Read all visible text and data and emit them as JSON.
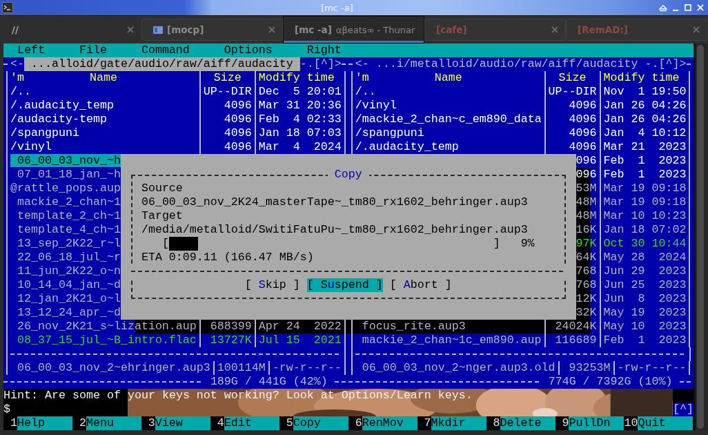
{
  "window": {
    "title": "[mc -a]"
  },
  "tabs": [
    {
      "label": "//",
      "selected": false,
      "alert": false,
      "icon": false
    },
    {
      "label": "[mocp]",
      "selected": false,
      "alert": false,
      "icon": true
    },
    {
      "label": "[mc -a]",
      "subtitle": "αβeats∞ - Thunar",
      "selected": true,
      "alert": false,
      "icon": false
    },
    {
      "label": "[cafe]",
      "selected": false,
      "alert": true,
      "icon": false
    },
    {
      "label": "[RemAD:]",
      "selected": false,
      "alert": true,
      "icon": false
    }
  ],
  "menu": [
    "Left",
    "File",
    "Command",
    "Options",
    "Right"
  ],
  "panels": [
    {
      "active": true,
      "nav_back": "<-",
      "path": "...alloid/gate/audio/raw/aiff/audacity",
      "nav_forward": "-.[^]>",
      "columns": [
        "'m",
        "Name",
        "Size",
        "Modify time"
      ],
      "rows": [
        {
          "kind": "dir",
          "name": "/..",
          "size": "UP--DIR",
          "modified": "Dec  5 20:01",
          "selected": false
        },
        {
          "kind": "dir",
          "name": "/.audacity_temp",
          "size": "4096",
          "modified": "Mar 31 20:36",
          "selected": false
        },
        {
          "kind": "dir",
          "name": "/audacity-temp",
          "size": "4096",
          "modified": "Feb  4 02:33",
          "selected": false
        },
        {
          "kind": "dir",
          "name": "/spangpuni",
          "size": "4096",
          "modified": "Jan 18 07:03",
          "selected": false
        },
        {
          "kind": "dir",
          "name": "/vinyl",
          "size": "4096",
          "modified": "Mar  4  2024",
          "selected": false
        },
        {
          "kind": "file",
          "name": "06_00_03_nov_~h",
          "selected": true
        },
        {
          "kind": "file",
          "name": "07_01_18_jan_~h",
          "selected": false
        },
        {
          "kind": "link",
          "name": "@rattle_pops.aup",
          "selected": false
        },
        {
          "kind": "file",
          "name": "mackie_2_chan~1",
          "selected": false
        },
        {
          "kind": "file",
          "name": "template_2_ch~1",
          "selected": false
        },
        {
          "kind": "file",
          "name": "template_4_ch~1",
          "selected": false
        },
        {
          "kind": "file",
          "name": "13_sep_2K22_r~l",
          "selected": false
        },
        {
          "kind": "file",
          "name": "22_06_18_jul_~r",
          "selected": false
        },
        {
          "kind": "file",
          "name": "11_jun_2K22_o~n",
          "selected": false
        },
        {
          "kind": "file",
          "name": "10_14_04_jan_~d",
          "selected": false
        },
        {
          "kind": "file",
          "name": "12_jan_2K21_o~l",
          "selected": false
        },
        {
          "kind": "file",
          "name": "13_12_24_apr_~d",
          "selected": false
        },
        {
          "kind": "file",
          "name": "26_nov_2K21_s~lization.aup",
          "size": "688399",
          "modified": "Apr 24  2022",
          "selected": false
        },
        {
          "kind": "media",
          "name": "08_37_15_jul_~B_intro.flac",
          "size": "13727K",
          "modified": "Jul 15  2021",
          "selected": false
        }
      ],
      "mini_status": {
        "name": "06_00_03_nov_2~ehringer.aup3",
        "size": "100114M",
        "perms": "-rw-r--r--"
      },
      "free_space": "189G / 441G (42%)"
    },
    {
      "active": false,
      "nav_back": "<-",
      "path": "...i/metalloid/audio/raw/aiff/audacity",
      "nav_forward": "-.[^]>",
      "columns": [
        "'m",
        "Name",
        "Size",
        "Modify time"
      ],
      "rows": [
        {
          "kind": "dir",
          "name": "/..",
          "size": "UP--DIR",
          "modified": "Nov  1 19:50",
          "selected": false
        },
        {
          "kind": "dir",
          "name": "/vinyl",
          "size": "4096",
          "modified": "Jan 26 04:26",
          "selected": false
        },
        {
          "kind": "dir",
          "name": "/mackie_2_chan~c_em890_data",
          "size": "4096",
          "modified": "Jan 26 04:26",
          "selected": false
        },
        {
          "kind": "dir",
          "name": "/spangpuni",
          "size": "4096",
          "modified": "Jan  4 10:12",
          "selected": false
        },
        {
          "kind": "dir",
          "name": "/.audacity_temp",
          "size": "4096",
          "modified": "Mar 21  2023",
          "selected": false
        },
        {
          "kind": "dir",
          "size": "096",
          "modified": "Feb  1  2023",
          "selected": false
        },
        {
          "kind": "dir",
          "size": "096",
          "modified": "Feb  1  2023",
          "selected": false
        },
        {
          "kind": "file",
          "size": "53M",
          "modified": "Mar 19 09:18",
          "selected": false
        },
        {
          "kind": "file",
          "size": "48M",
          "modified": "Mar 19 09:18",
          "selected": false
        },
        {
          "kind": "file",
          "size": "48M",
          "modified": "Mar 10 10:23",
          "selected": false
        },
        {
          "kind": "file",
          "size": "16K",
          "modified": "Jan 18 07:02",
          "selected": false
        },
        {
          "kind": "media",
          "size": "97K",
          "modified": "Oct 30 10:44",
          "selected": false
        },
        {
          "kind": "file",
          "size": "64K",
          "modified": "May 28  2024",
          "selected": false
        },
        {
          "kind": "file",
          "size": "768",
          "modified": "Jun 29  2023",
          "selected": false
        },
        {
          "kind": "file",
          "size": "768",
          "modified": "Jun 25  2023",
          "selected": false
        },
        {
          "kind": "file",
          "size": "12K",
          "modified": "Jun  8  2023",
          "selected": false
        },
        {
          "kind": "file",
          "size": "32K",
          "modified": "May 19  2023",
          "selected": false
        },
        {
          "kind": "file",
          "name": "focus_rite.aup3",
          "size": "24024K",
          "modified": "May 10  2023",
          "selected": false
        },
        {
          "kind": "file",
          "name": "mackie_2_chan~1c_em890.aup",
          "size": "116689",
          "modified": "Feb  1  2023",
          "selected": false
        }
      ],
      "mini_status": {
        "name": "06_00_03_nov_2~nger.aup3.old",
        "size": "93253M",
        "perms": "-rw-r--r--"
      },
      "free_space": "774G / 7392G (10%)"
    }
  ],
  "dialog": {
    "title": "Copy",
    "source_label": "Source",
    "source": "06_00_03_nov_2K24_masterTape~_tm80_rx1602_behringer.aup3",
    "target_label": "Target",
    "target": "/media/metalloid/SwitiFatuPu~_tm80_rx1602_behringer.aup3",
    "progress": {
      "open": "[",
      "close": "]",
      "level": 0.09,
      "percent": "9%"
    },
    "eta": "ETA 0:09.11 (166.47 MB/s)",
    "buttons": [
      {
        "prefix": "[ ",
        "hotkey": "S",
        "rest": "kip ]",
        "selected": false
      },
      {
        "prefix": "[ S",
        "hotkey": "u",
        "rest": "spend ]",
        "selected": true
      },
      {
        "prefix": "[ ",
        "hotkey": "A",
        "rest": "bort ]",
        "selected": false
      }
    ]
  },
  "hint": "Hint: Are some of your keys not working? Look at Options/Learn keys.",
  "prompt": "$",
  "history_button": "[^]",
  "function_keys": [
    {
      "number": "1",
      "label": "Help"
    },
    {
      "number": "2",
      "label": "Menu"
    },
    {
      "number": "3",
      "label": "View"
    },
    {
      "number": "4",
      "label": "Edit"
    },
    {
      "number": "5",
      "label": "Copy"
    },
    {
      "number": "6",
      "label": "RenMov"
    },
    {
      "number": "7",
      "label": "Mkdir"
    },
    {
      "number": "8",
      "label": "Delete"
    },
    {
      "number": "9",
      "label": "PullDn"
    },
    {
      "number": "10",
      "label": "Quit"
    }
  ]
}
